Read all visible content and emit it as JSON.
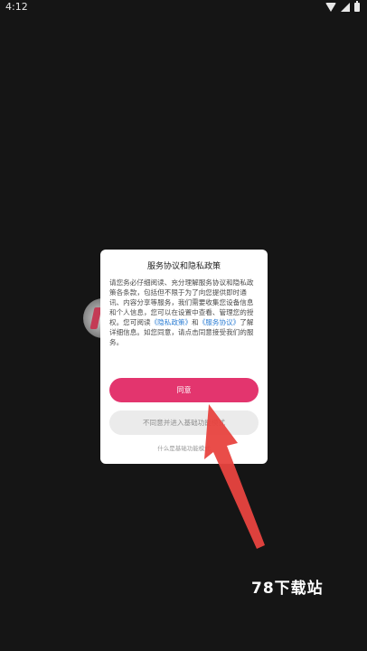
{
  "statusbar": {
    "time": "4:12"
  },
  "dialog": {
    "title": "服务协议和隐私政策",
    "body_part1": "请您务必仔细阅读、充分理解服务协议和隐私政策各条款，包括但不限于为了向您提供即时通讯、内容分享等服务，我们需要收集您设备信息和个人信息，您可以在设置中查看、管理您的授权。您可阅读",
    "privacy_link": "《隐私政策》",
    "and_text": "和",
    "service_link": "《服务协议》",
    "body_part2": "了解详细信息。如您同意，请点击同意接受我们的服务。",
    "agree_label": "同意",
    "refuse_label": "不同意并进入基础功能模式",
    "basic_link": "什么是基础功能模式"
  },
  "watermark": {
    "text": "78下载站"
  },
  "colors": {
    "accent": "#e3356e",
    "link": "#2f7fd4",
    "arrow": "#e8433f"
  }
}
